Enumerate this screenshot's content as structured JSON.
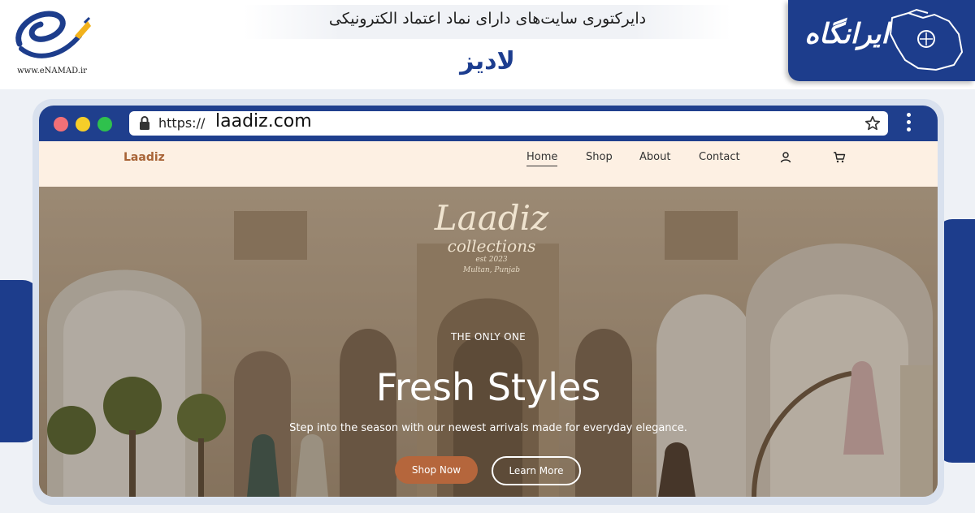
{
  "header": {
    "title": "دایرکتوری سایت‌های دارای نماد اعتماد الکترونیکی",
    "site_name": "لادیز",
    "enamad_url": "www.eNAMAD.ir",
    "irangah_logo_text": "ایرانگاه"
  },
  "browser": {
    "url_protocol": "https://",
    "url_domain": "laadiz.com",
    "icons": [
      "lock-icon",
      "star-icon",
      "kebab-menu-icon"
    ]
  },
  "nav": {
    "logo": "Laadiz",
    "items": [
      {
        "label": "Home",
        "active": true
      },
      {
        "label": "Shop",
        "active": false
      },
      {
        "label": "About",
        "active": false
      },
      {
        "label": "Contact",
        "active": false
      }
    ],
    "icons": [
      "user-icon",
      "cart-icon"
    ]
  },
  "hero": {
    "brand_name": "Laadiz",
    "brand_sub": "collections",
    "brand_est": "est 2023",
    "brand_city": "Multan, Punjab",
    "eyebrow": "THE ONLY ONE",
    "title": "Fresh Styles",
    "subtitle": "Step into the season with our newest arrivals made for everyday elegance.",
    "primary_button": "Shop Now",
    "secondary_button": "Learn More"
  },
  "colors": {
    "brand_blue": "#1d3d8c",
    "nav_bg": "#fdf0e3",
    "accent_brown": "#b5663c",
    "logo_brown": "#a86336"
  }
}
